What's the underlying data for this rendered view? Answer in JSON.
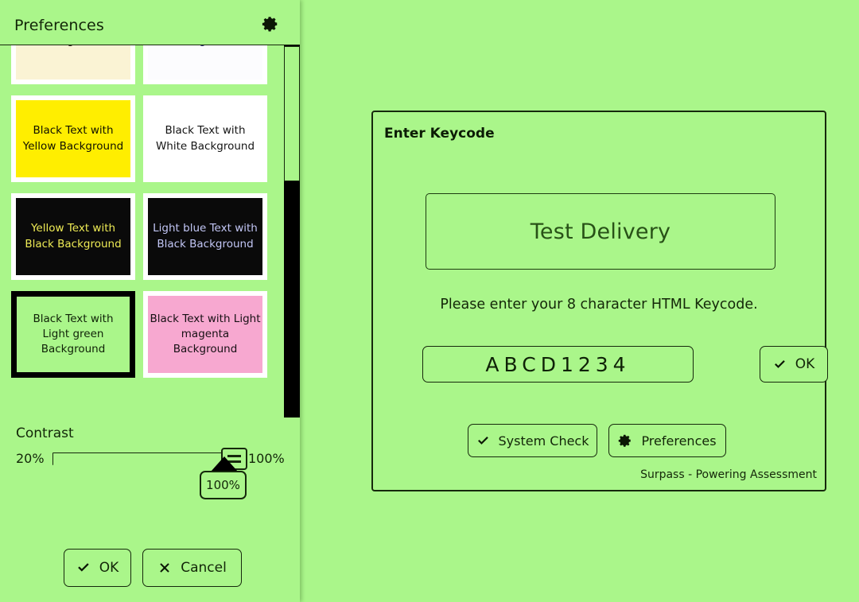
{
  "colors": {
    "app_background": "#aaf68a",
    "ink": "#122608",
    "selected_border": "#000000"
  },
  "preferences_panel": {
    "title": "Preferences",
    "gear_icon": "gear-icon",
    "themes": [
      {
        "label": "Background",
        "bg": "#faf3d4",
        "fg": "#2a2418",
        "selected": false,
        "clipped": true
      },
      {
        "label": "Background",
        "bg": "#fcfcfe",
        "fg": "#2b2f74",
        "selected": false,
        "clipped": true
      },
      {
        "label": "Black Text with Yellow Background",
        "bg": "#ffee00",
        "fg": "#111100",
        "selected": false,
        "clipped": false
      },
      {
        "label": "Black Text with White Background",
        "bg": "#ffffff",
        "fg": "#141414",
        "selected": false,
        "clipped": false
      },
      {
        "label": "Yellow Text with Black Background",
        "bg": "#0a0a0a",
        "fg": "#eeeb55",
        "selected": false,
        "clipped": false
      },
      {
        "label": "Light blue Text with Black Background",
        "bg": "#0a0a0a",
        "fg": "#c2c6f5",
        "selected": false,
        "clipped": false
      },
      {
        "label": "Black Text with Light green Background",
        "bg": "#aaf68a",
        "fg": "#0f2207",
        "selected": true,
        "clipped": false
      },
      {
        "label": "Black Text with Light magenta Background",
        "bg": "#f7a8d0",
        "fg": "#171014",
        "selected": false,
        "clipped": false
      }
    ],
    "contrast": {
      "label": "Contrast",
      "min_label": "20%",
      "max_label": "100%",
      "value_label": "100%",
      "value": 100,
      "min": 20,
      "max": 100
    },
    "buttons": {
      "ok": "OK",
      "cancel": "Cancel",
      "ok_icon": "check-icon",
      "cancel_icon": "cross-icon"
    }
  },
  "keycode_dialog": {
    "title": "Enter Keycode",
    "test_name": "Test Delivery",
    "instruction": "Please enter your 8 character HTML Keycode.",
    "keycode_value": "ABCD1234",
    "keycode_placeholder": "",
    "ok_label": "OK",
    "ok_icon": "check-icon",
    "system_check_label": "System Check",
    "system_check_icon": "check-icon",
    "preferences_label": "Preferences",
    "preferences_icon": "gear-icon",
    "brand": "Surpass - Powering Assessment"
  }
}
